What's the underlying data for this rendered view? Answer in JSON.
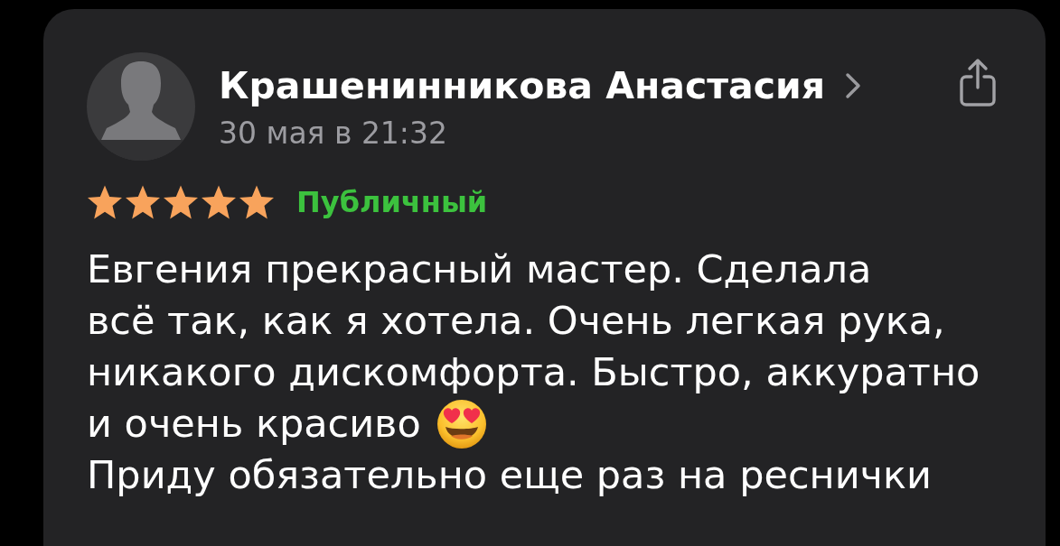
{
  "review": {
    "author": {
      "name": "Крашенинникова Анастасия",
      "date": "30 мая в 21:32"
    },
    "stars": 5,
    "visibility": "Публичный",
    "lines": [
      "Евгения прекрасный мастер. Сделала",
      "всё так, как я хотела. Очень легкая рука,",
      "никакого дискомфорта. Быстро, аккуратно",
      "и очень красиво",
      "Приду обязательно еще раз на реснички"
    ]
  }
}
